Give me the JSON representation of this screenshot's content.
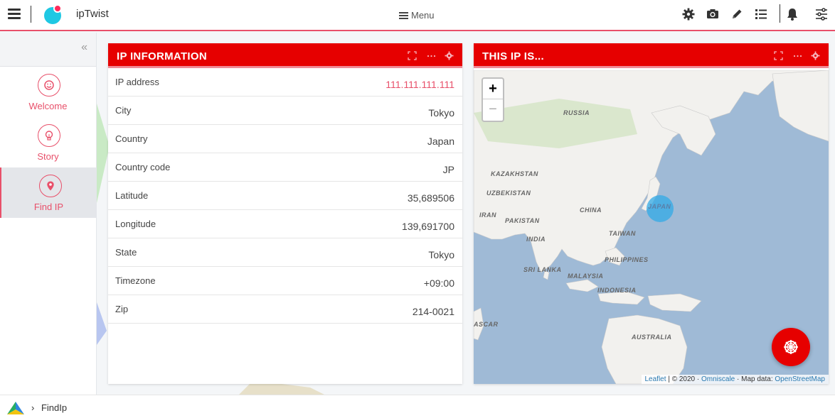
{
  "app": {
    "title": "ipTwist",
    "menu_label": "Menu"
  },
  "toolbar_icons": [
    "gear-icon",
    "camera-icon",
    "pencil-icon",
    "list-icon",
    "bell-icon",
    "sliders-icon"
  ],
  "sidebar": {
    "collapse_glyph": "«",
    "items": [
      {
        "label": "Welcome",
        "icon": "smile-icon",
        "active": false
      },
      {
        "label": "Story",
        "icon": "lightbulb-icon",
        "active": false
      },
      {
        "label": "Find IP",
        "icon": "location-pin-icon",
        "active": true
      }
    ]
  },
  "ip_panel": {
    "title": "IP INFORMATION",
    "rows": [
      {
        "key": "IP address",
        "value": "111.111.111.111"
      },
      {
        "key": "City",
        "value": "Tokyo"
      },
      {
        "key": "Country",
        "value": "Japan"
      },
      {
        "key": "Country code",
        "value": "JP"
      },
      {
        "key": "Latitude",
        "value": "35,689506"
      },
      {
        "key": "Longitude",
        "value": "139,691700"
      },
      {
        "key": "State",
        "value": "Tokyo"
      },
      {
        "key": "Timezone",
        "value": "+09:00"
      },
      {
        "key": "Zip",
        "value": "214-0021"
      }
    ]
  },
  "map_panel": {
    "title": "THIS IP IS...",
    "zoom_in": "+",
    "zoom_out": "−",
    "labels": [
      "RUSSIA",
      "KAZAKHSTAN",
      "UZBEKISTAN",
      "IRAN",
      "PAKISTAN",
      "CHINA",
      "JAPAN",
      "TAIWAN",
      "INDIA",
      "PHILIPPINES",
      "SRI LANKA",
      "MALAYSIA",
      "INDONESIA",
      "ASCAR",
      "AUSTRALIA"
    ],
    "attribution": {
      "leaflet": "Leaflet",
      "copyright": "| © 2020 ·",
      "omniscale": "Omniscale",
      "mapdata": "· Map data:",
      "osm": "OpenStreetMap"
    }
  },
  "footer": {
    "breadcrumb_sep": "›",
    "breadcrumb": "FindIp"
  },
  "colors": {
    "accent": "#e8506a",
    "panel_red": "#e60000",
    "water": "#9fbad6",
    "land": "#f2f1ee"
  }
}
